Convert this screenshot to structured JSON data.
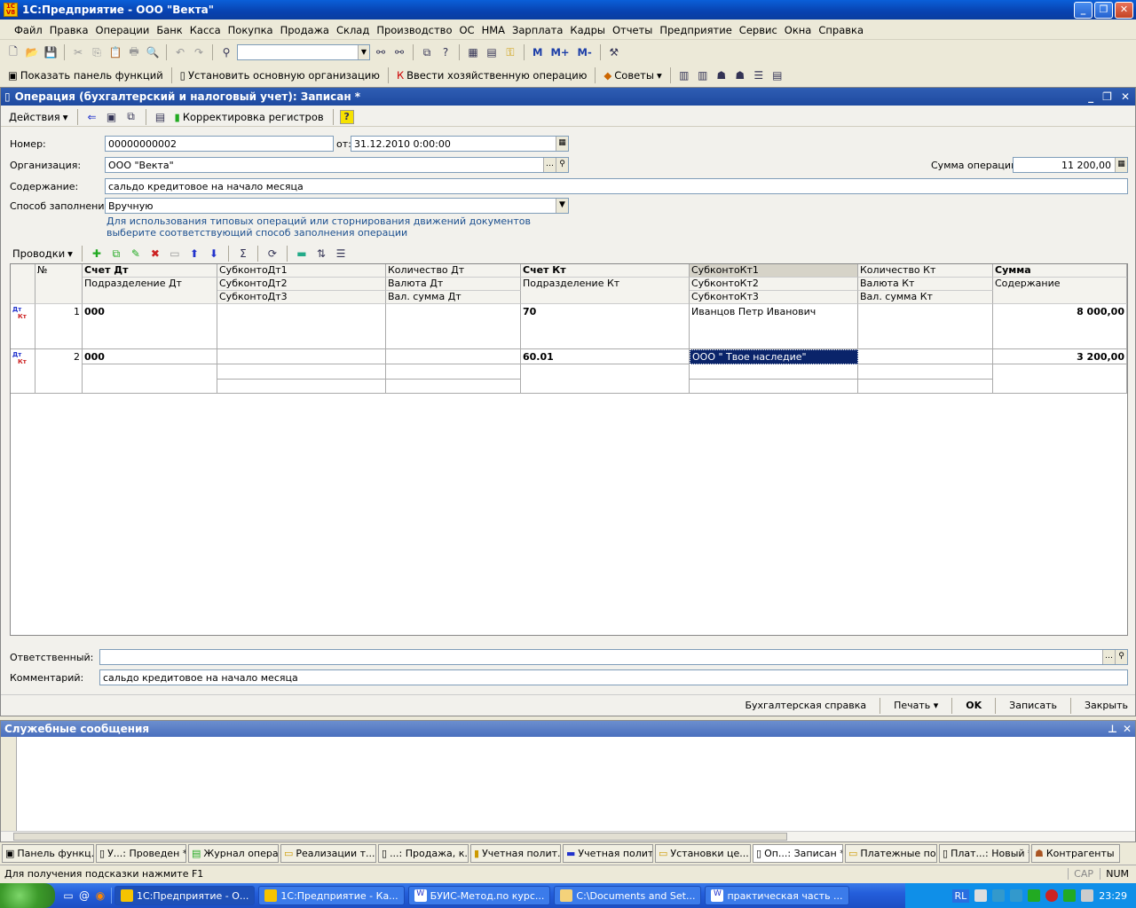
{
  "window": {
    "title": "1С:Предприятие - ООО \"Векта\""
  },
  "menu": [
    "Файл",
    "Правка",
    "Операции",
    "Банк",
    "Касса",
    "Покупка",
    "Продажа",
    "Склад",
    "Производство",
    "ОС",
    "НМА",
    "Зарплата",
    "Кадры",
    "Отчеты",
    "Предприятие",
    "Сервис",
    "Окна",
    "Справка"
  ],
  "toolbar2": {
    "show_panel": "Показать панель функций",
    "set_org": "Установить основную организацию",
    "enter_op": "Ввести хозяйственную операцию",
    "tips": "Советы"
  },
  "toolbar1": {
    "m": "М",
    "mplus": "М+",
    "mminus": "М-"
  },
  "doc": {
    "title": "Операция (бухгалтерский и налоговый учет): Записан *",
    "actions": "Действия",
    "correction": "Корректировка регистров",
    "number_label": "Номер:",
    "number": "00000000002",
    "date_label": "от:",
    "date": "31.12.2010  0:00:00",
    "org_label": "Организация:",
    "org": "ООО \"Векта\"",
    "sum_label": "Сумма операции:",
    "sum": "11 200,00",
    "content_label": "Содержание:",
    "content": "сальдо кредитовое на начало месяца",
    "fill_label": "Способ заполнения:",
    "fill": "Вручную",
    "hint1": "Для использования типовых операций или сторнирования движений документов",
    "hint2": "выберите соответствующий способ заполнения операции",
    "entries_btn": "Проводки",
    "resp_label": "Ответственный:",
    "resp": "",
    "comment_label": "Комментарий:",
    "comment": "сальдо кредитовое на начало месяца",
    "btn_ref": "Бухгалтерская справка",
    "btn_print": "Печать",
    "btn_ok": "OK",
    "btn_save": "Записать",
    "btn_close": "Закрыть"
  },
  "grid": {
    "headers": {
      "num": "№",
      "dt": "Счет Дт",
      "dt2": "Подразделение Дт",
      "sdt1": "СубконтоДт1",
      "sdt2": "СубконтоДт2",
      "sdt3": "СубконтоДт3",
      "qdt": "Количество Дт",
      "cdt": "Валюта Дт",
      "vdt": "Вал. сумма Дт",
      "kt": "Счет Кт",
      "kt2": "Подразделение Кт",
      "skt1": "СубконтоКт1",
      "skt2": "СубконтоКт2",
      "skt3": "СубконтоКт3",
      "qkt": "Количество Кт",
      "ckt": "Валюта Кт",
      "vkt": "Вал. сумма Кт",
      "sum": "Сумма",
      "content": "Содержание"
    },
    "dtkt_dt": "Дт",
    "dtkt_kt": "Кт",
    "rows": [
      {
        "n": "1",
        "dt": "000",
        "kt": "70",
        "skt1": "Иванцов Петр Иванович",
        "sum": "8 000,00"
      },
      {
        "n": "2",
        "dt": "000",
        "kt": "60.01",
        "skt1": "ООО \" Твое наследие\"",
        "sum": "3 200,00"
      }
    ]
  },
  "messages": {
    "title": "Служебные сообщения"
  },
  "tabs": [
    "Панель функц...",
    "У...: Проведен *",
    "Журнал опера...",
    "Реализации т...",
    "...: Продажа, к...",
    "Учетная полит...",
    "Учетная полит...",
    "Установки це...",
    "Оп...: Записан *",
    "Платежные по...",
    "Плат...: Новый *",
    "Контрагенты"
  ],
  "status": {
    "hint": "Для получения подсказки нажмите F1",
    "cap": "CAP",
    "num": "NUM"
  },
  "taskbar": {
    "items": [
      "1С:Предприятие - О...",
      "1С:Предприятие - Ка...",
      "БУИС-Метод.по курс...",
      "C:\\Documents and Set...",
      "практическая часть ..."
    ],
    "lang": "RL",
    "time": "23:29"
  }
}
